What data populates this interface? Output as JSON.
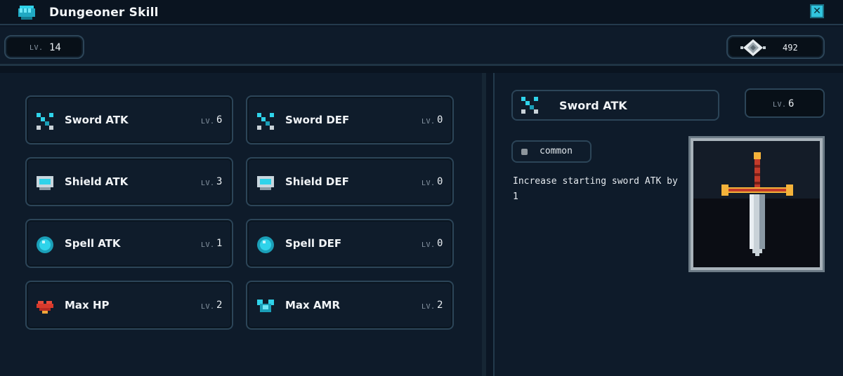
{
  "window": {
    "title": "Dungeoner Skill",
    "close_icon": "close-icon"
  },
  "player": {
    "level_tag": "LV.",
    "level": "14",
    "currency_amount": "492"
  },
  "skills": [
    {
      "name": "Sword ATK",
      "level_tag": "LV.",
      "level": "6",
      "icon": "sword-icon"
    },
    {
      "name": "Sword DEF",
      "level_tag": "LV.",
      "level": "0",
      "icon": "sword-icon"
    },
    {
      "name": "Shield ATK",
      "level_tag": "LV.",
      "level": "3",
      "icon": "shield-icon"
    },
    {
      "name": "Shield DEF",
      "level_tag": "LV.",
      "level": "0",
      "icon": "shield-icon"
    },
    {
      "name": "Spell ATK",
      "level_tag": "LV.",
      "level": "1",
      "icon": "orb-icon"
    },
    {
      "name": "Spell DEF",
      "level_tag": "LV.",
      "level": "0",
      "icon": "orb-icon"
    },
    {
      "name": "Max HP",
      "level_tag": "LV.",
      "level": "2",
      "icon": "heart-icon"
    },
    {
      "name": "Max AMR",
      "level_tag": "LV.",
      "level": "2",
      "icon": "armor-icon"
    }
  ],
  "detail": {
    "name": "Sword ATK",
    "level_tag": "LV.",
    "level": "6",
    "rarity": "common",
    "description": "Increase starting sword ATK by 1"
  },
  "colors": {
    "accent": "#31c4de",
    "panel": "#0e1b2a",
    "border": "#2c4558"
  }
}
